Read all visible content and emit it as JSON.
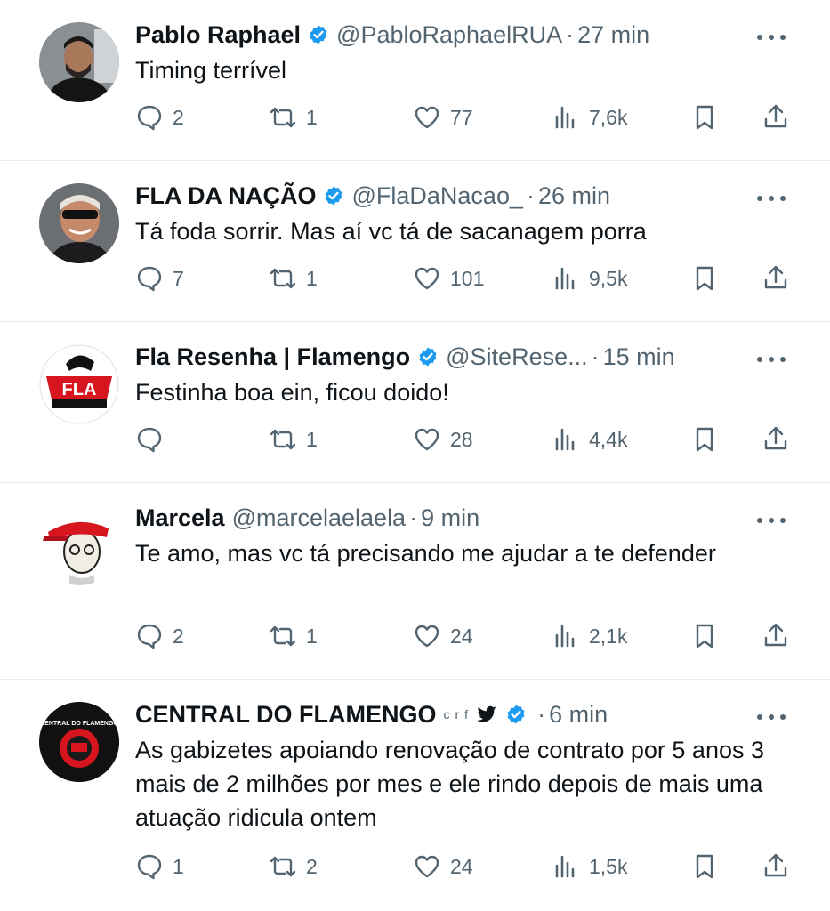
{
  "tweets": [
    {
      "name": "Pablo Raphael",
      "verified": true,
      "handle": "@PabloRaphaelRUA",
      "time": "27 min",
      "text": "Timing terrível",
      "replies": "2",
      "retweets": "1",
      "likes": "77",
      "views": "7,6k"
    },
    {
      "name": "FLA DA NAÇÃO",
      "verified": true,
      "handle": "@FlaDaNacao_",
      "time": "26 min",
      "text": "Tá foda sorrir. Mas aí vc tá de sacanagem porra",
      "replies": "7",
      "retweets": "1",
      "likes": "101",
      "views": "9,5k"
    },
    {
      "name": "Fla Resenha | Flamengo",
      "verified": true,
      "handle": "@SiteRese...",
      "time": "15 min",
      "text": "Festinha boa ein, ficou doido!",
      "replies": "",
      "retweets": "1",
      "likes": "28",
      "views": "4,4k"
    },
    {
      "name": "Marcela",
      "verified": false,
      "handle": "@marcelaelaela",
      "time": "9 min",
      "text": "Te amo, mas vc tá precisando me ajudar a te defender",
      "replies": "2",
      "retweets": "1",
      "likes": "24",
      "views": "2,1k"
    },
    {
      "name": "CENTRAL DO FLAMENGO",
      "name_extra": "crf",
      "verified": true,
      "handle": "",
      "time": "6 min",
      "text": "As gabizetes apoiando renovação de contrato por 5 anos 3 mais de 2 milhões por mes e ele rindo depois de mais uma atuação ridicula ontem",
      "replies": "1",
      "retweets": "2",
      "likes": "24",
      "views": "1,5k"
    }
  ],
  "logos": {
    "fla_resenha": "FLA",
    "central": "CENTRAL DO FLAMENGO"
  },
  "colors": {
    "verified": "#1d9bf0",
    "secondary": "#536471",
    "divider": "#e6ecf0",
    "flamengo_red": "#d7151f"
  },
  "icons": [
    "reply-icon",
    "retweet-icon",
    "like-icon",
    "views-icon",
    "bookmark-icon",
    "share-icon",
    "more-icon",
    "verified-icon",
    "bird-icon"
  ]
}
